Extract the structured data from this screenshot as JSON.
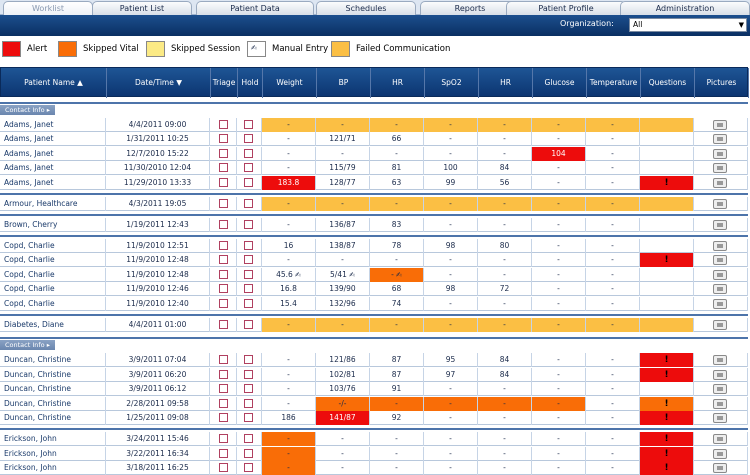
{
  "tabs": [
    {
      "label": "Worklist",
      "active": true
    },
    {
      "label": "Patient List"
    },
    {
      "label": "Patient Data"
    },
    {
      "label": "Schedules"
    },
    {
      "label": "Reports"
    },
    {
      "label": "Patient Profile"
    },
    {
      "label": "Administration"
    }
  ],
  "org": {
    "label": "Organization:",
    "value": "All"
  },
  "legend": [
    {
      "label": "Alert",
      "color": "#ed0c0c"
    },
    {
      "label": "Skipped Vital",
      "color": "#f96d07"
    },
    {
      "label": "Skipped Session",
      "color": "#fbea85"
    },
    {
      "label": "Manual Entry",
      "color": "#ffffff",
      "icon": "hand-icon"
    },
    {
      "label": "Failed Communication",
      "color": "#fbbf44"
    }
  ],
  "columns": [
    "Patient Name",
    "Date/Time",
    "Triage",
    "Hold",
    "Weight",
    "BP",
    "HR",
    "SpO2",
    "HR",
    "Glucose",
    "Temperature",
    "Questions",
    "Pictures"
  ],
  "contact_info_label": "Contact Info",
  "rows": [
    {
      "name": "Adams, Janet",
      "dt": "4/4/2011 09:00",
      "w": "-",
      "bp": "-",
      "hr": "-",
      "sp": "-",
      "hr2": "-",
      "gl": "-",
      "te": "-",
      "q": "",
      "fill": "yel",
      "cells": {}
    },
    {
      "name": "Adams, Janet",
      "dt": "1/31/2011 10:25",
      "w": "-",
      "bp": "121/71",
      "hr": "66",
      "sp": "-",
      "hr2": "-",
      "gl": "-",
      "te": "-",
      "q": ""
    },
    {
      "name": "Adams, Janet",
      "dt": "12/7/2010 15:22",
      "w": "-",
      "bp": "-",
      "hr": "-",
      "sp": "-",
      "hr2": "-",
      "gl": "104",
      "te": "-",
      "q": "",
      "cells": {
        "gl": "red"
      }
    },
    {
      "name": "Adams, Janet",
      "dt": "11/30/2010 12:04",
      "w": "-",
      "bp": "115/79",
      "hr": "81",
      "sp": "100",
      "hr2": "84",
      "gl": "-",
      "te": "-",
      "q": ""
    },
    {
      "name": "Adams, Janet",
      "dt": "11/29/2010 13:33",
      "w": "183.8",
      "bp": "128/77",
      "hr": "63",
      "sp": "99",
      "hr2": "56",
      "gl": "-",
      "te": "-",
      "q": "!",
      "cells": {
        "w": "red",
        "q": "red"
      }
    },
    {
      "name": "Armour, Healthcare",
      "dt": "4/3/2011 19:05",
      "w": "-",
      "bp": "-",
      "hr": "-",
      "sp": "-",
      "hr2": "-",
      "gl": "-",
      "te": "-",
      "q": "",
      "fill": "yel"
    },
    {
      "name": "Brown, Cherry",
      "dt": "1/19/2011 12:43",
      "w": "-",
      "bp": "136/87",
      "hr": "83",
      "sp": "-",
      "hr2": "-",
      "gl": "-",
      "te": "-",
      "q": ""
    },
    {
      "name": "Copd, Charlie",
      "dt": "11/9/2010 12:51",
      "w": "16",
      "bp": "138/87",
      "hr": "78",
      "sp": "98",
      "hr2": "80",
      "gl": "-",
      "te": "-",
      "q": ""
    },
    {
      "name": "Copd, Charlie",
      "dt": "11/9/2010 12:48",
      "w": "-",
      "bp": "-",
      "hr": "-",
      "sp": "-",
      "hr2": "-",
      "gl": "-",
      "te": "-",
      "q": "!",
      "cells": {
        "q": "red"
      }
    },
    {
      "name": "Copd, Charlie",
      "dt": "11/9/2010 12:48",
      "w": "45.6",
      "bp": "5/41",
      "hr": "-",
      "sp": "-",
      "hr2": "-",
      "gl": "-",
      "te": "-",
      "q": "",
      "cells": {
        "hr": "ora"
      },
      "hand": [
        "w",
        "bp",
        "hr"
      ]
    },
    {
      "name": "Copd, Charlie",
      "dt": "11/9/2010 12:46",
      "w": "16.8",
      "bp": "139/90",
      "hr": "68",
      "sp": "98",
      "hr2": "72",
      "gl": "-",
      "te": "-",
      "q": ""
    },
    {
      "name": "Copd, Charlie",
      "dt": "11/9/2010 12:40",
      "w": "15.4",
      "bp": "132/96",
      "hr": "74",
      "sp": "-",
      "hr2": "-",
      "gl": "-",
      "te": "-",
      "q": ""
    },
    {
      "name": "Diabetes, Diane",
      "dt": "4/4/2011 01:00",
      "w": "-",
      "bp": "-",
      "hr": "-",
      "sp": "-",
      "hr2": "-",
      "gl": "-",
      "te": "-",
      "q": "",
      "fill": "yel"
    },
    {
      "name": "Duncan, Christine",
      "dt": "3/9/2011 07:04",
      "w": "-",
      "bp": "121/86",
      "hr": "87",
      "sp": "95",
      "hr2": "84",
      "gl": "-",
      "te": "-",
      "q": "!",
      "cells": {
        "q": "red"
      }
    },
    {
      "name": "Duncan, Christine",
      "dt": "3/9/2011 06:20",
      "w": "-",
      "bp": "102/81",
      "hr": "87",
      "sp": "97",
      "hr2": "84",
      "gl": "-",
      "te": "-",
      "q": "!",
      "cells": {
        "q": "red"
      }
    },
    {
      "name": "Duncan, Christine",
      "dt": "3/9/2011 06:12",
      "w": "-",
      "bp": "103/76",
      "hr": "91",
      "sp": "-",
      "hr2": "-",
      "gl": "-",
      "te": "-",
      "q": ""
    },
    {
      "name": "Duncan, Christine",
      "dt": "2/28/2011 09:58",
      "w": "-",
      "bp": "-/-",
      "hr": "-",
      "sp": "-",
      "hr2": "-",
      "gl": "-",
      "te": "-",
      "q": "!",
      "cells": {
        "bp": "ora",
        "hr": "ora",
        "sp": "ora",
        "hr2": "ora",
        "gl": "ora",
        "q": "ora"
      }
    },
    {
      "name": "Duncan, Christine",
      "dt": "1/25/2011 09:08",
      "w": "186",
      "bp": "141/87",
      "hr": "92",
      "sp": "-",
      "hr2": "-",
      "gl": "-",
      "te": "-",
      "q": "!",
      "cells": {
        "bp": "red",
        "q": "red"
      }
    },
    {
      "name": "Erickson, John",
      "dt": "3/24/2011 15:46",
      "w": "-",
      "bp": "-",
      "hr": "-",
      "sp": "-",
      "hr2": "-",
      "gl": "-",
      "te": "-",
      "q": "!",
      "cells": {
        "w": "ora",
        "q": "red"
      }
    },
    {
      "name": "Erickson, John",
      "dt": "3/22/2011 16:34",
      "w": "-",
      "bp": "-",
      "hr": "-",
      "sp": "-",
      "hr2": "-",
      "gl": "-",
      "te": "-",
      "q": "!",
      "cells": {
        "w": "ora",
        "q": "red"
      }
    },
    {
      "name": "Erickson, John",
      "dt": "3/18/2011 16:25",
      "w": "-",
      "bp": "-",
      "hr": "-",
      "sp": "-",
      "hr2": "-",
      "gl": "-",
      "te": "-",
      "q": "!",
      "cells": {
        "w": "ora",
        "q": "red"
      }
    }
  ]
}
